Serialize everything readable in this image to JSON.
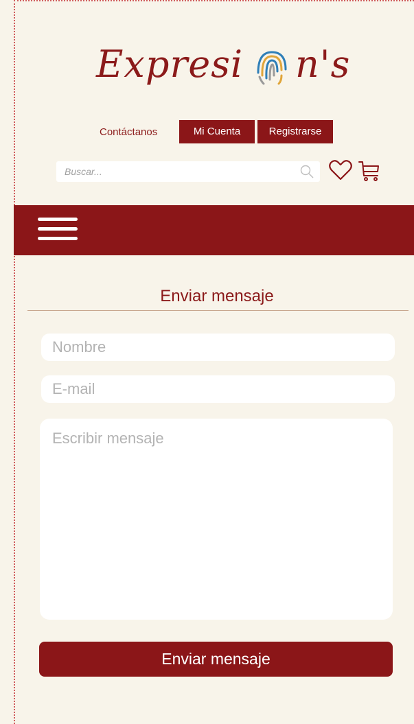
{
  "brand": {
    "logo_text_left": "Expresi",
    "logo_text_right": "n's",
    "logo_icon": "fingerprint-icon",
    "colors": {
      "primary": "#8b1618",
      "background": "#f8f4ea"
    }
  },
  "topnav": {
    "contact_label": "Contáctanos",
    "account_label": "Mi Cuenta",
    "register_label": "Registrarse"
  },
  "search": {
    "placeholder": "Buscar...",
    "icon": "search-icon"
  },
  "header_icons": [
    "heart-icon",
    "cart-icon"
  ],
  "navbar": {
    "menu_icon": "hamburger-menu-icon"
  },
  "form": {
    "title": "Enviar mensaje",
    "name_placeholder": "Nombre",
    "email_placeholder": "E-mail",
    "message_placeholder": "Escribir mensaje",
    "submit_label": "Enviar mensaje"
  }
}
